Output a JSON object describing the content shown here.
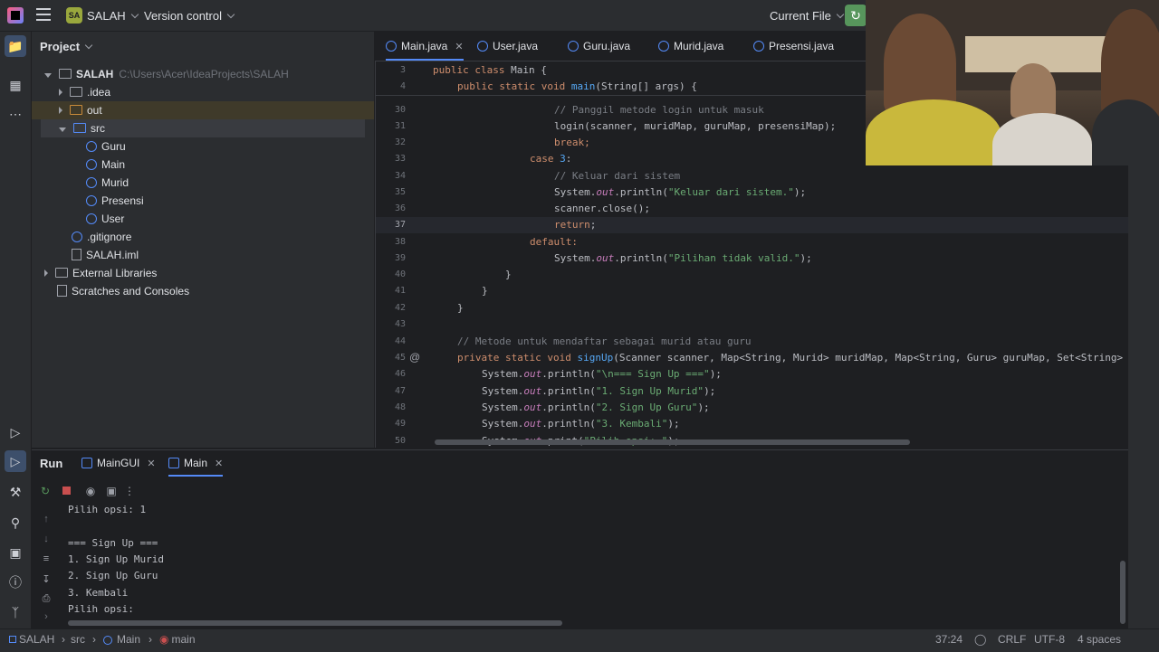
{
  "topbar": {
    "project_badge": "SA",
    "project_name": "SALAH",
    "version_control": "Version control",
    "run_config": "Current File"
  },
  "project_panel": {
    "title": "Project",
    "root_name": "SALAH",
    "root_path": "C:\\Users\\Acer\\IdeaProjects\\SALAH",
    "items": [
      {
        "label": ".idea"
      },
      {
        "label": "out"
      },
      {
        "label": "src"
      },
      {
        "label": "Guru"
      },
      {
        "label": "Main"
      },
      {
        "label": "Murid"
      },
      {
        "label": "Presensi"
      },
      {
        "label": "User"
      },
      {
        "label": ".gitignore"
      },
      {
        "label": "SALAH.iml"
      },
      {
        "label": "External Libraries"
      },
      {
        "label": "Scratches and Consoles"
      }
    ]
  },
  "editor": {
    "tabs": [
      {
        "label": "Main.java"
      },
      {
        "label": "User.java"
      },
      {
        "label": "Guru.java"
      },
      {
        "label": "Murid.java"
      },
      {
        "label": "Presensi.java"
      }
    ],
    "sticky": [
      {
        "num": "3",
        "text": "public class Main {"
      },
      {
        "num": "4",
        "text": "    public static void main(String[] args) {"
      }
    ],
    "line_numbers": [
      "30",
      "31",
      "32",
      "33",
      "34",
      "35",
      "36",
      "37",
      "38",
      "39",
      "40",
      "41",
      "42",
      "43",
      "44",
      "45",
      "46",
      "47",
      "48",
      "49",
      "50"
    ],
    "lines": {
      "l30": "// Panggil metode login untuk masuk",
      "l31": "login(scanner, muridMap, guruMap, presensiMap);",
      "l32": "break;",
      "l33a": "case ",
      "l33b": "3",
      "l33c": ":",
      "l34": "// Keluar dari sistem",
      "l35a": "System.",
      "l35b": "out",
      "l35c": ".println(",
      "l35d": "\"Keluar dari sistem.\"",
      "l35e": ");",
      "l36": "scanner.close();",
      "l37a": "return",
      "l37b": ";",
      "l38": "default:",
      "l39a": "System.",
      "l39b": "out",
      "l39c": ".println(",
      "l39d": "\"Pilihan tidak valid.\"",
      "l39e": ");",
      "l40": "}",
      "l41": "}",
      "l42": "}",
      "l44": "// Metode untuk mendaftar sebagai murid atau guru",
      "l45a": "private static void ",
      "l45b": "signUp",
      "l45c": "(Scanner scanner, Map<String, Murid> muridMap, Map<String, Guru> guruMap, Set<String>",
      "l46a": "System.",
      "l46b": "out",
      "l46c": ".println(",
      "l46d": "\"\\n=== Sign Up ===\"",
      "l46e": ");",
      "l47a": "System.",
      "l47b": "out",
      "l47c": ".println(",
      "l47d": "\"1. Sign Up Murid\"",
      "l47e": ");",
      "l48a": "System.",
      "l48b": "out",
      "l48c": ".println(",
      "l48d": "\"2. Sign Up Guru\"",
      "l48e": ");",
      "l49a": "System.",
      "l49b": "out",
      "l49c": ".println(",
      "l49d": "\"3. Kembali\"",
      "l49e": ");",
      "l50a": "System.",
      "l50b": "out",
      "l50c": ".print(",
      "l50d": "\"Pilih opsi: \"",
      "l50e": ");"
    },
    "gutter_marker": "@"
  },
  "run_panel": {
    "title": "Run",
    "tabs": [
      {
        "label": "MainGUI"
      },
      {
        "label": "Main"
      }
    ],
    "output": [
      "Pilih opsi: 1",
      "",
      "=== Sign Up ===",
      "1. Sign Up Murid",
      "2. Sign Up Guru",
      "3. Kembali",
      "Pilih opsi:"
    ]
  },
  "statusbar": {
    "breadcrumb": [
      "SALAH",
      "src",
      "Main",
      "main"
    ],
    "position": "37:24",
    "line_sep": "CRLF",
    "encoding": "UTF-8",
    "indent": "4 spaces"
  },
  "colors": {
    "accent": "#548af7",
    "keyword": "#cf8e6d",
    "string": "#6aab73",
    "run_green": "#57965c"
  }
}
